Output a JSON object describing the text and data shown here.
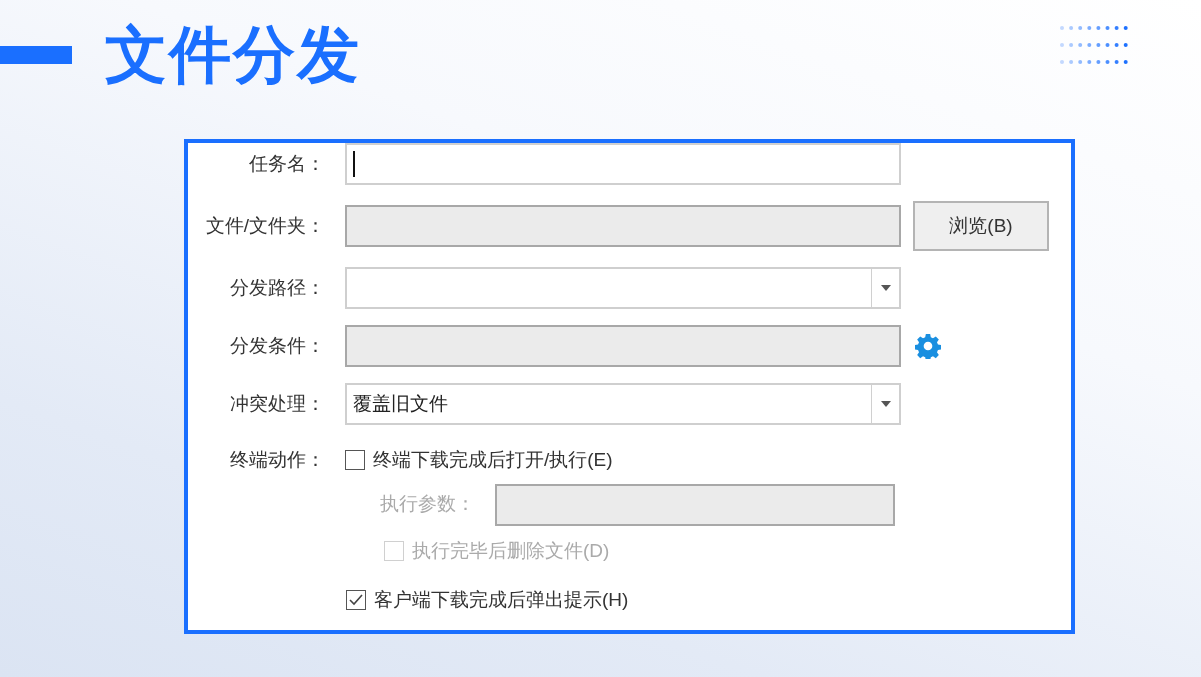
{
  "title": "文件分发",
  "form": {
    "rows": [
      {
        "label": "任务名：",
        "kind": "text",
        "focused": true,
        "disabled": false
      },
      {
        "label": "文件/文件夹：",
        "kind": "text",
        "focused": false,
        "disabled": true,
        "button": "浏览(B)"
      },
      {
        "label": "分发路径：",
        "kind": "dropdown",
        "disabled": false
      },
      {
        "label": "分发条件：",
        "kind": "text",
        "focused": false,
        "disabled": true,
        "settings": true
      },
      {
        "label": "冲突处理：",
        "kind": "dropdown",
        "disabled": false,
        "value": "覆盖旧文件"
      }
    ],
    "terminal_action": {
      "label": "终端动作：",
      "checkbox": {
        "label": "终端下载完成后打开/执行(E)",
        "checked": false,
        "disabled": false
      },
      "param": {
        "label": "执行参数：",
        "disabled": true
      },
      "delete_checkbox": {
        "label": "执行完毕后删除文件(D)",
        "checked": false,
        "disabled": true
      }
    },
    "notify_checkbox": {
      "label": "客户端下载完成后弹出提示(H)",
      "checked": true,
      "disabled": false
    }
  }
}
